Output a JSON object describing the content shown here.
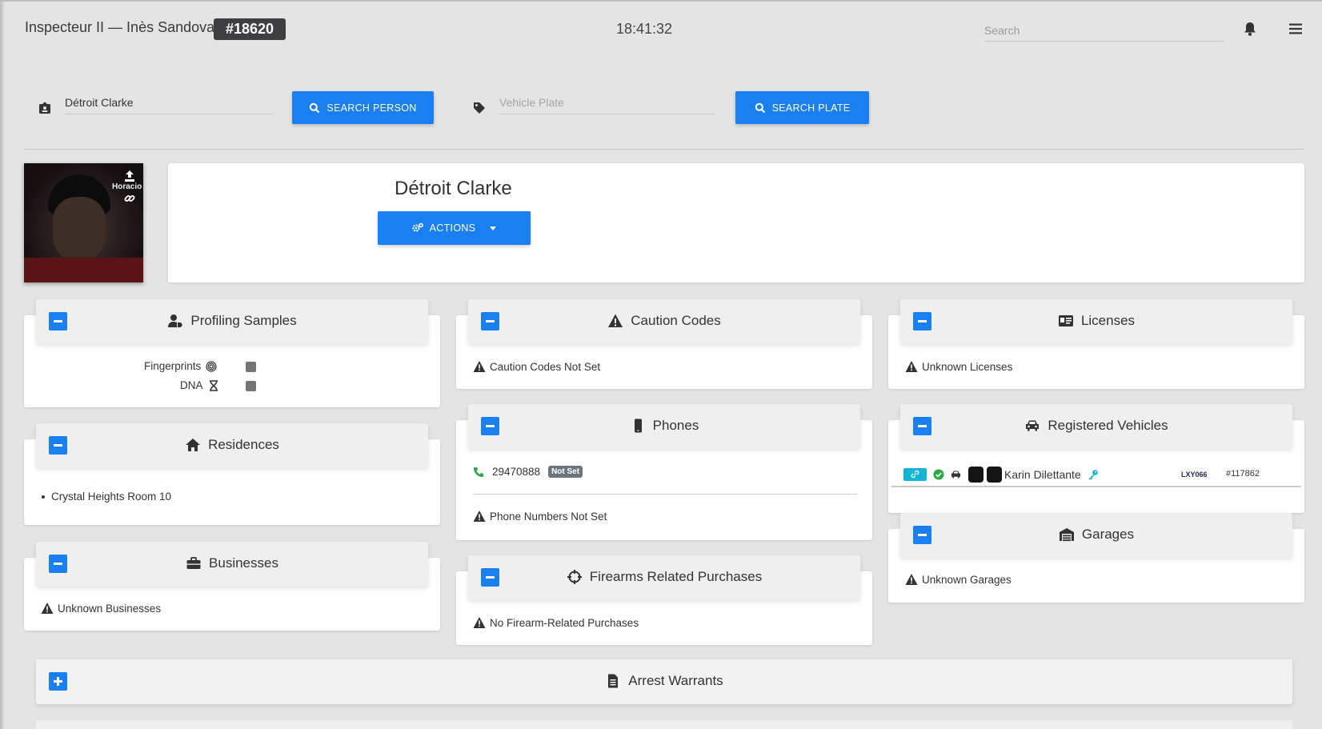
{
  "header": {
    "title": "Inspecteur II — Inès Sandoval",
    "badge": "#18620",
    "clock": "18:41:32",
    "search_placeholder": "Search"
  },
  "search": {
    "person_value": "Détroit Clarke",
    "person_button": "SEARCH PERSON",
    "plate_placeholder": "Vehicle Plate",
    "plate_button": "SEARCH PLATE"
  },
  "profile": {
    "photo_caption": "Horacio Ga",
    "name": "Détroit Clarke",
    "actions_button": "ACTIONS"
  },
  "cards": {
    "profiling": {
      "title": "Profiling Samples",
      "fingerprints": "Fingerprints",
      "dna": "DNA"
    },
    "caution": {
      "title": "Caution Codes",
      "message": "Caution Codes Not Set"
    },
    "licenses": {
      "title": "Licenses",
      "message": "Unknown Licenses"
    },
    "residences": {
      "title": "Residences",
      "items": [
        "Crystal Heights Room 10"
      ]
    },
    "phones": {
      "title": "Phones",
      "number": "29470888",
      "number_badge": "Not Set",
      "message": "Phone Numbers Not Set"
    },
    "vehicles": {
      "title": "Registered Vehicles",
      "items": [
        {
          "name": "Karin Dilettante",
          "plate": "LXY066",
          "id": "#117862"
        }
      ]
    },
    "garages": {
      "title": "Garages",
      "message": "Unknown Garages"
    },
    "businesses": {
      "title": "Businesses",
      "message": "Unknown Businesses"
    },
    "firearms": {
      "title": "Firearms Related Purchases",
      "message": "No Firearm-Related Purchases"
    },
    "warrants": {
      "title": "Arrest Warrants"
    }
  },
  "colors": {
    "primary": "#1a7ff0",
    "badge_dark": "#3d3f43",
    "link_badge": "#10b5d8",
    "ok_green": "#28a745"
  }
}
